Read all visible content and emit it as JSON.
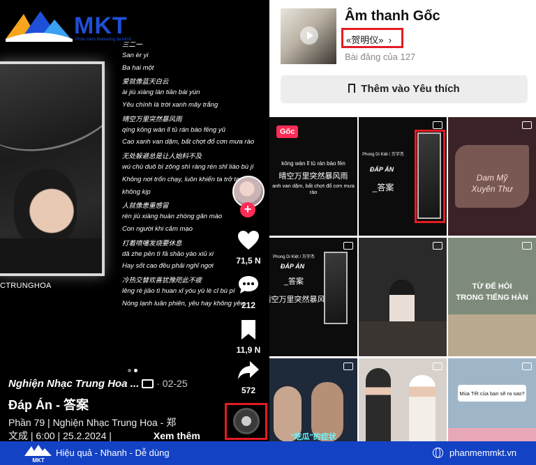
{
  "logo": {
    "brand": "MKT",
    "tagline": "Phần mềm Marketing đa kênh"
  },
  "video": {
    "photo_caption": "CTRUNGHOA",
    "lyrics": [
      "三二一",
      "San èr yi",
      "Ba hai một",
      "爱就像蓝天白云",
      "ài jiù xiàng lán tiān bái yún",
      "Yêu chính là trời xanh mây trắng",
      "晴空万里突然暴风雨",
      "qíng kōng wàn lǐ tū rán bào fēng yǔ",
      "Cao xanh van dặm, bất chợt đổ cơn mưa rào",
      "无处躲避总是让人始料不及",
      "wú chù duǒ bì zǒng shì ràng rén shǐ liào bù jí",
      "Không nơi trốn chạy, luôn khiến ta trở tay",
      "không kịp",
      "人就像患重感冒",
      "rén jiù xiàng huàn zhòng gǎn mào",
      "Con người khi cảm mạo",
      "打着喷嚏发烧要休息",
      "dǎ zhe pēn tì fā shāo yào xiū xi",
      "Hay sốt cao đều phải nghỉ ngơi",
      "冷热交替欢喜犹豫咫此不疲",
      "lěng rè jiāo tì huan xǐ yóu yù lè cǐ bù pí",
      "Nóng lạnh luân phiên, yêu hay không yêu"
    ],
    "actions": {
      "likes": "71,5 N",
      "comments": "212",
      "saves": "11,9 N",
      "shares": "572"
    },
    "author": "Nghiện Nhạc Trung Hoa ...",
    "date": "· 02-25",
    "title": "Đáp Án - 答案",
    "description_line1": "Phần 79 | Nghiện Nhạc Trung Hoa - 郑",
    "description_line2": "文成 | 6:00 | 25.2.2024 |",
    "see_more": "Xem thêm"
  },
  "sound": {
    "title": "Âm thanh Gốc",
    "artist": "«贺明仪»",
    "artist_chevron": "›",
    "post_count": "Bài đăng của 127",
    "favorite_button": "Thêm vào Yêu thích"
  },
  "grid": {
    "original_badge": "Gốc",
    "tile1_line1": "kōng wàn lǐ tū rán bào fēn",
    "tile1_line2": "晴空万里突然暴风雨",
    "tile1_line3": "anh van dặm, bất chợt đổ cơn mưa rào",
    "tile2_small": "Phong Di Kiệt / 万字杰",
    "tile2_title": "ĐÁP ÁN",
    "tile2_cn": "_答案",
    "tile3_line1": "Dam Mỹ",
    "tile3_line2": "Xuyên Thư",
    "tile4_small": "Phong Di Kiệt / 万字杰",
    "tile4_title": "ĐÁP ÁN",
    "tile4_cn": "_答案",
    "tile4_lyric": "晴空万里突然暴风雨",
    "tile6_line1": "TỪ ĐỂ HỎI",
    "tile6_line2": "TRONG TIẾNG HÀN",
    "tile8_cn": "\"吃瓜\"的症状",
    "tile9_caption": "Mùa Tết của bạn sẽ ra sao?"
  },
  "footer": {
    "slogan": "Hiệu quả - Nhanh - Dễ dùng",
    "website": "phanmemmkt.vn",
    "logo_text": "MKT"
  },
  "colors": {
    "highlight_red": "#e51b23",
    "tiktok_pink": "#fe2c55",
    "brand_blue": "#1342c4"
  }
}
